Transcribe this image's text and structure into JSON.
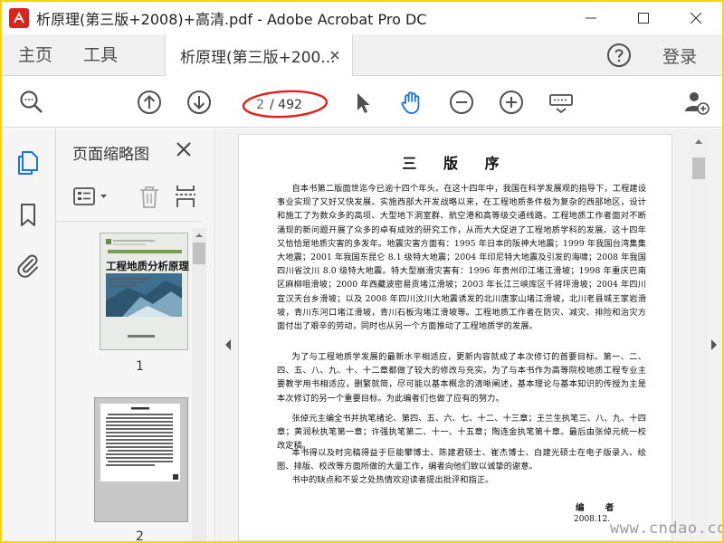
{
  "window": {
    "title": "析原理(第三版+2008)+高清.pdf - Adobe Acrobat Pro DC"
  },
  "tabs": {
    "home": "主页",
    "tools": "工具",
    "document": "析原理(第三版+200...",
    "login": "登录"
  },
  "toolbar": {
    "page_current": "2",
    "page_total": "/ 492"
  },
  "thumbnails": {
    "header": "页面缩略图",
    "items": [
      {
        "number": "1",
        "cover_title": "工程地质分析原理"
      },
      {
        "number": "2"
      }
    ]
  },
  "document": {
    "title": "三 版 序",
    "paragraphs": [
      "自本书第二版面世迄今已逾十四个年头。在这十四年中，我国在科学发展观的指导下，工程建设事业实现了又好又快发展。实施西部大开发战略以来，在工程地质条件极为复杂的西部地区，设计和施工了为数众多的高坝、大型地下洞室群、航空港和高等级交通线路。工程地质工作者面对不断涌现的新问题开展了众多的卓有成效的研究工作，从而大大促进了工程地质学科的发展。这十四年又恰恰是地质灾害的多发年。地震灾害方面有：1995 年日本的阪神大地震；1999 年我国台湾集集大地震；2001 年我国东昆仑 8.1 级特大地震；2004 年印尼特大地震及引发的海啸；2008 年我国四川省汶川 8.0 级特大地震。特大型崩滑灾害有：1996 年贵州印江堵江滑坡；1998 年重庆巴南区麻柳咀滑坡；2000 年西藏波密易贡堵江滑坡；2003 年长江三峡库区千将坪滑坡；2004 年四川宣汉天台乡滑坡；以及 2008 年四川汶川大地震诱发的北川唐家山堵江滑坡，北川老县城王家岩滑坡，青川东河口堵江滑坡，青川石板沟堵江滑坡等。工程地质工作者在防灾、减灾、排险和治灾方面付出了艰辛的劳动，同时也从另一个方面推动了工程地质学的发展。",
      "为了与工程地质学发展的最新水平相适应，更新内容就成了本次修订的首要目标。第一、二、四、五、八、九、十、十二章都做了较大的修改与充实。为了与本书作为高等院校地质工程专业主要教学用书相适应，删繁就简，尽可能以基本概念的清晰阐述，基本理论与基本知识的传授为主是本次修订的另一个重要目标。为此编者们也做了应有的努力。",
      "张倬元主编全书并执笔绪论、第四、五、六、七、十二、十三章；王兰生执笔三、八、九、十四章；黄润秋执笔第一章；许强执笔第二、十一、十五章；陶连金执笔第十章。最后由张倬元统一校改定稿。",
      "本书得以及时完稿得益于巨能攀博士、陈建君硕士、崔杰博士、白建光硕士在电子版录入、绘图、排版、校改等方面所做的大量工作，编者向他们致以诚挚的谢意。",
      "书中的缺点和不妥之处热情欢迎读者提出批评和指正。"
    ],
    "signature": "编 者",
    "date": "2008.12."
  },
  "watermark": "www.cndao.com",
  "colors": {
    "accent_blue": "#1473e6",
    "icon_gray": "#505050",
    "highlight_red": "#e0201c",
    "outer_border": "#ffd500"
  }
}
